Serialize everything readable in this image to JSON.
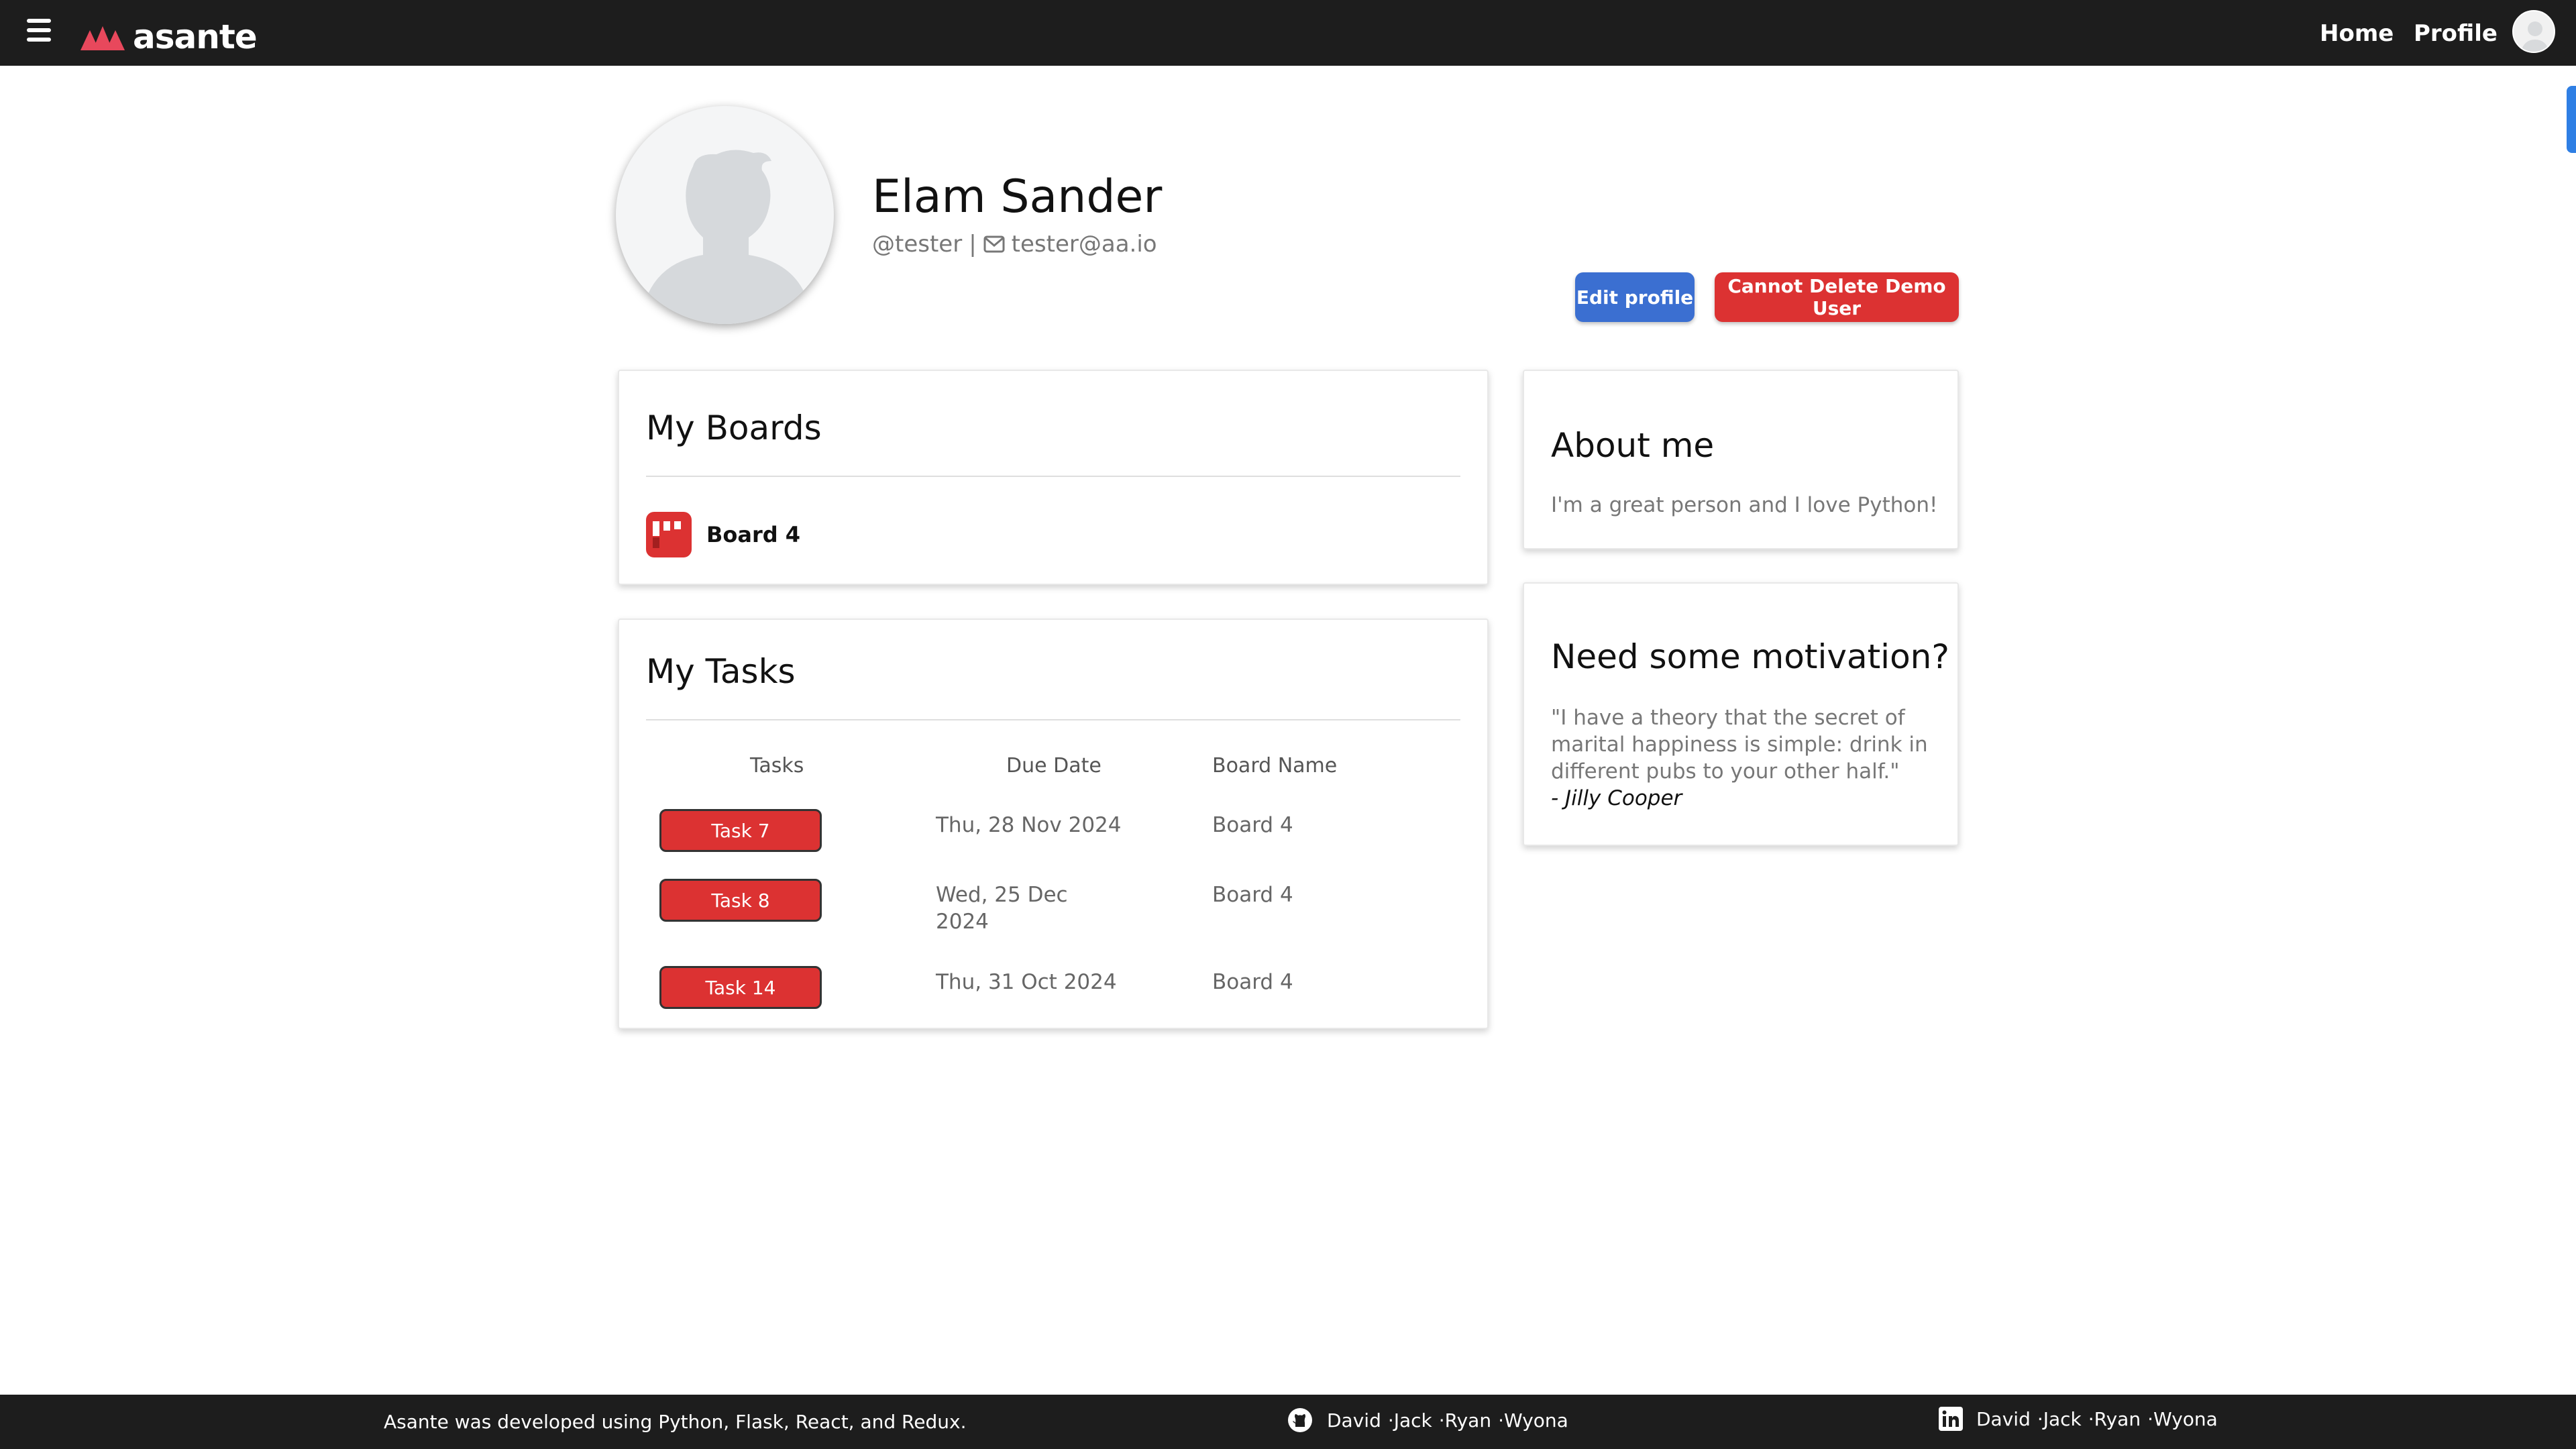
{
  "nav": {
    "brand": "asante",
    "home": "Home",
    "profile": "Profile"
  },
  "profile": {
    "name": "Elam Sander",
    "username": "@tester",
    "separator": "|",
    "email": "tester@aa.io",
    "edit_button": "Edit profile",
    "delete_button": "Cannot Delete Demo User"
  },
  "boards": {
    "title": "My Boards",
    "items": [
      {
        "label": "Board 4"
      }
    ]
  },
  "tasks": {
    "title": "My Tasks",
    "headers": [
      "Tasks",
      "Due Date",
      "Board Name"
    ],
    "rows": [
      {
        "task": "Task 7",
        "due_line1": "Thu, 28 Nov 2024",
        "due_line2": "",
        "board": "Board 4"
      },
      {
        "task": "Task 8",
        "due_line1": "Wed, 25 Dec",
        "due_line2": "2024",
        "board": "Board 4"
      },
      {
        "task": "Task 14",
        "due_line1": "Thu, 31 Oct 2024",
        "due_line2": "",
        "board": "Board 4"
      }
    ]
  },
  "about": {
    "title": "About me",
    "text": "I'm a great person and I love Python!"
  },
  "motivation": {
    "title": "Need some motivation?",
    "quote": "\"I have a theory that the secret of marital happiness is simple: drink in different pubs to your other half.\"",
    "author": "- Jilly Cooper"
  },
  "footer": {
    "text": "Asante was developed using Python, Flask, React, and Redux.",
    "github_names": [
      "David ",
      "·Jack ",
      "·Ryan ",
      "·Wyona"
    ],
    "linkedin_names": [
      "David ",
      "·Jack ",
      "·Ryan ",
      "·Wyona"
    ]
  },
  "colors": {
    "navbar": "#1d1d1d",
    "accent_red": "#dc3232",
    "accent_blue": "#3b6fd1"
  },
  "icons": {
    "menu": "hamburger-icon",
    "logo": "asante-logo-icon",
    "email": "envelope-icon",
    "board": "board-icon",
    "github": "github-icon",
    "linkedin": "linkedin-icon"
  }
}
